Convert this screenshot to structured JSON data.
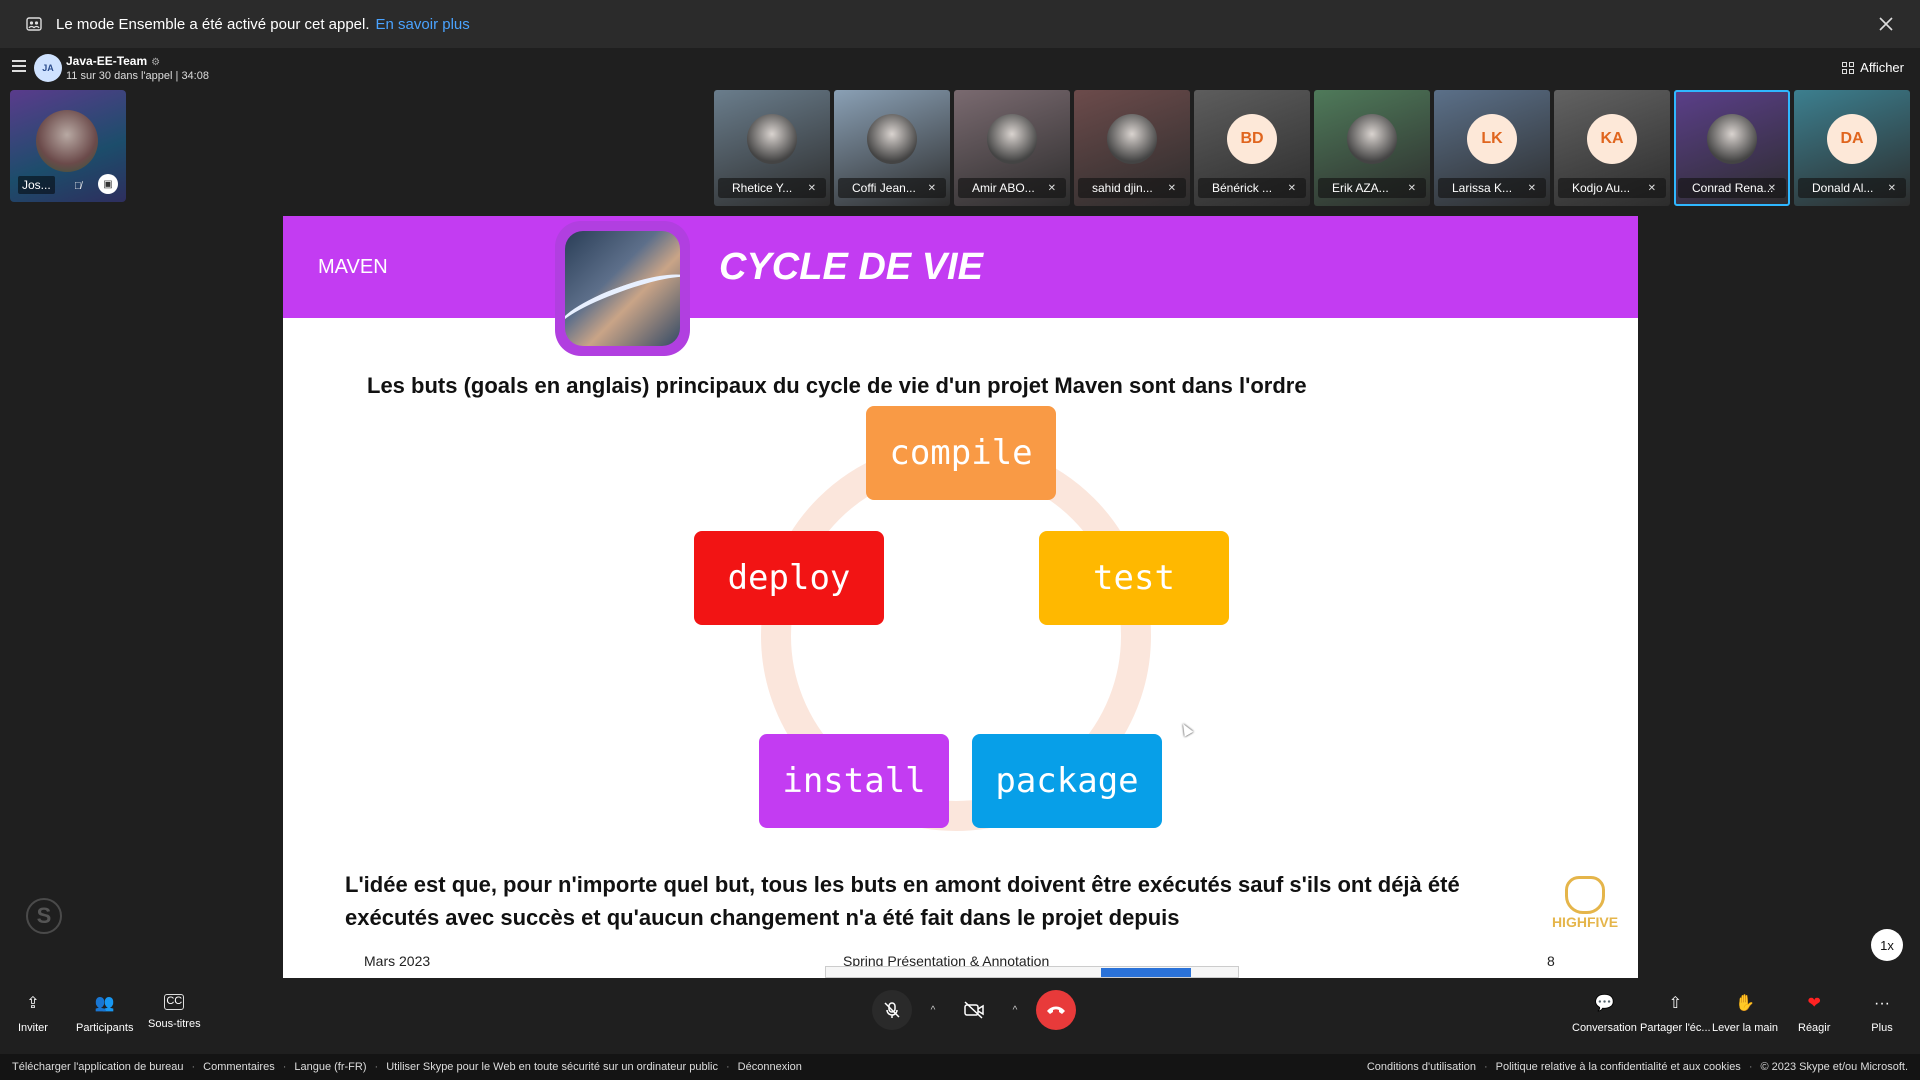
{
  "banner": {
    "icon": "people-icon",
    "text": "Le mode Ensemble a été activé pour cet appel.",
    "link": "En savoir plus"
  },
  "header": {
    "team_initials": "JA",
    "team_name": "Java-EE-Team",
    "call_info": "11 sur 30 dans l'appel | 34:08",
    "view_button": "Afficher"
  },
  "self_view": {
    "name": "Jos..."
  },
  "participants": [
    {
      "name": "Rhetice Y...",
      "initials": "",
      "bg": "#6a7d8c"
    },
    {
      "name": "Coffi Jean...",
      "initials": "",
      "bg": "#8aa0b5"
    },
    {
      "name": "Amir ABO...",
      "initials": "",
      "bg": "#7a6a70"
    },
    {
      "name": "sahid djin...",
      "initials": "",
      "bg": "#6c4b4b"
    },
    {
      "name": "Bénérick ...",
      "initials": "BD",
      "bg": "#5d5d5d"
    },
    {
      "name": "Erik AZA...",
      "initials": "",
      "bg": "#4f7a5a"
    },
    {
      "name": "Larissa K...",
      "initials": "LK",
      "bg": "#5b7089"
    },
    {
      "name": "Kodjo Au...",
      "initials": "KA",
      "bg": "#626262"
    },
    {
      "name": "Conrad Rena...",
      "initials": "",
      "bg": "#5b3f8a"
    },
    {
      "name": "Donald Al...",
      "initials": "DA",
      "bg": "#3c7f8f"
    }
  ],
  "slide": {
    "section": "MAVEN",
    "title": "CYCLE DE VIE",
    "lead": "Les buts (goals en anglais) principaux du cycle de vie d'un projet Maven sont dans l'ordre",
    "steps": {
      "compile": "compile",
      "test": "test",
      "package": "package",
      "install": "install",
      "deploy": "deploy"
    },
    "note": "L'idée est que, pour n'importe quel but, tous les buts en amont doivent être exécutés sauf s'ils ont déjà été exécutés avec succès et qu'aucun changement n'a été fait dans le projet depuis",
    "logo_text": "HIGHFIVE",
    "footer_left": "Mars 2023",
    "footer_center": "Spring Présentation & Annotation",
    "footer_right": "8"
  },
  "speed": "1x",
  "toolbar": {
    "invite": "Inviter",
    "participants": "Participants",
    "captions": "Sous-titres",
    "conversation": "Conversation",
    "share": "Partager l'éc...",
    "raise_hand": "Lever la main",
    "react": "Réagir",
    "more": "Plus"
  },
  "footer": {
    "download": "Télécharger l'application de bureau",
    "comments": "Commentaires",
    "language": "Langue (fr-FR)",
    "safe_use": "Utiliser Skype pour le Web en toute sécurité sur un ordinateur public",
    "logout": "Déconnexion",
    "terms": "Conditions d'utilisation",
    "privacy": "Politique relative à la confidentialité et aux cookies",
    "copyright": "© 2023 Skype et/ou Microsoft."
  },
  "colors": {
    "slide_header": "#c33cf2",
    "compile": "#f99a45",
    "test": "#ffb800",
    "deploy": "#f21414",
    "install": "#c33cf2",
    "package": "#079fe8",
    "hangup": "#e83a3a"
  }
}
